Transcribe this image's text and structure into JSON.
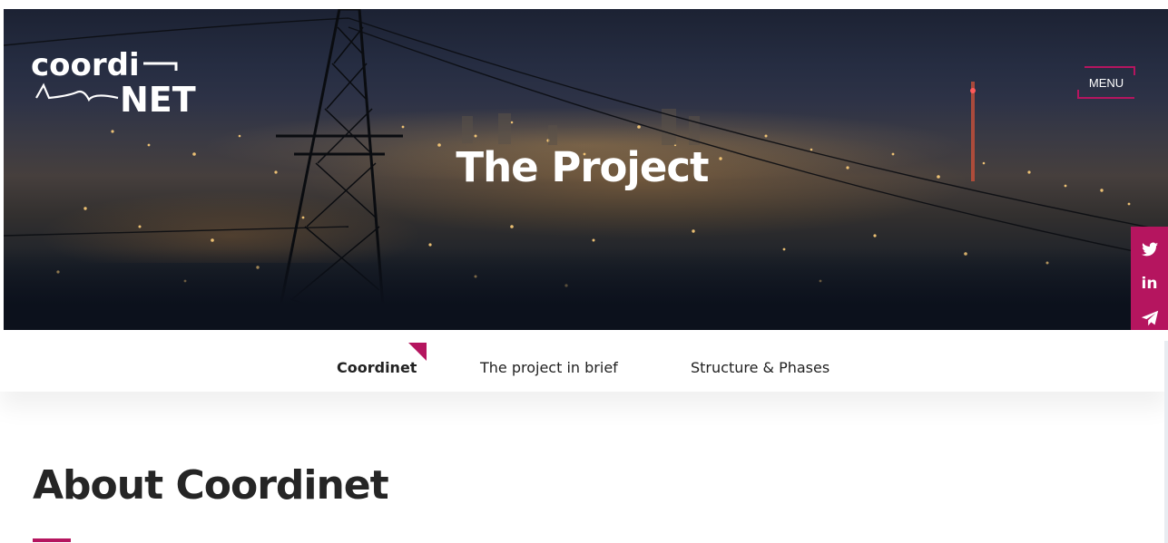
{
  "hero": {
    "title": "The Project"
  },
  "logo": {
    "line1": "coordi",
    "line2": "NET"
  },
  "menu": {
    "label": "MENU"
  },
  "social": {
    "items": [
      {
        "name": "twitter-icon"
      },
      {
        "name": "linkedin-icon",
        "label": "in"
      },
      {
        "name": "telegram-icon"
      }
    ]
  },
  "subnav": {
    "items": [
      {
        "label": "Coordinet",
        "active": true
      },
      {
        "label": "The project in brief",
        "active": false
      },
      {
        "label": "Structure & Phases",
        "active": false
      }
    ]
  },
  "section": {
    "title": "About Coordinet"
  },
  "colors": {
    "accent": "#b5155f",
    "text": "#252525",
    "hero_text": "#ffffff"
  }
}
